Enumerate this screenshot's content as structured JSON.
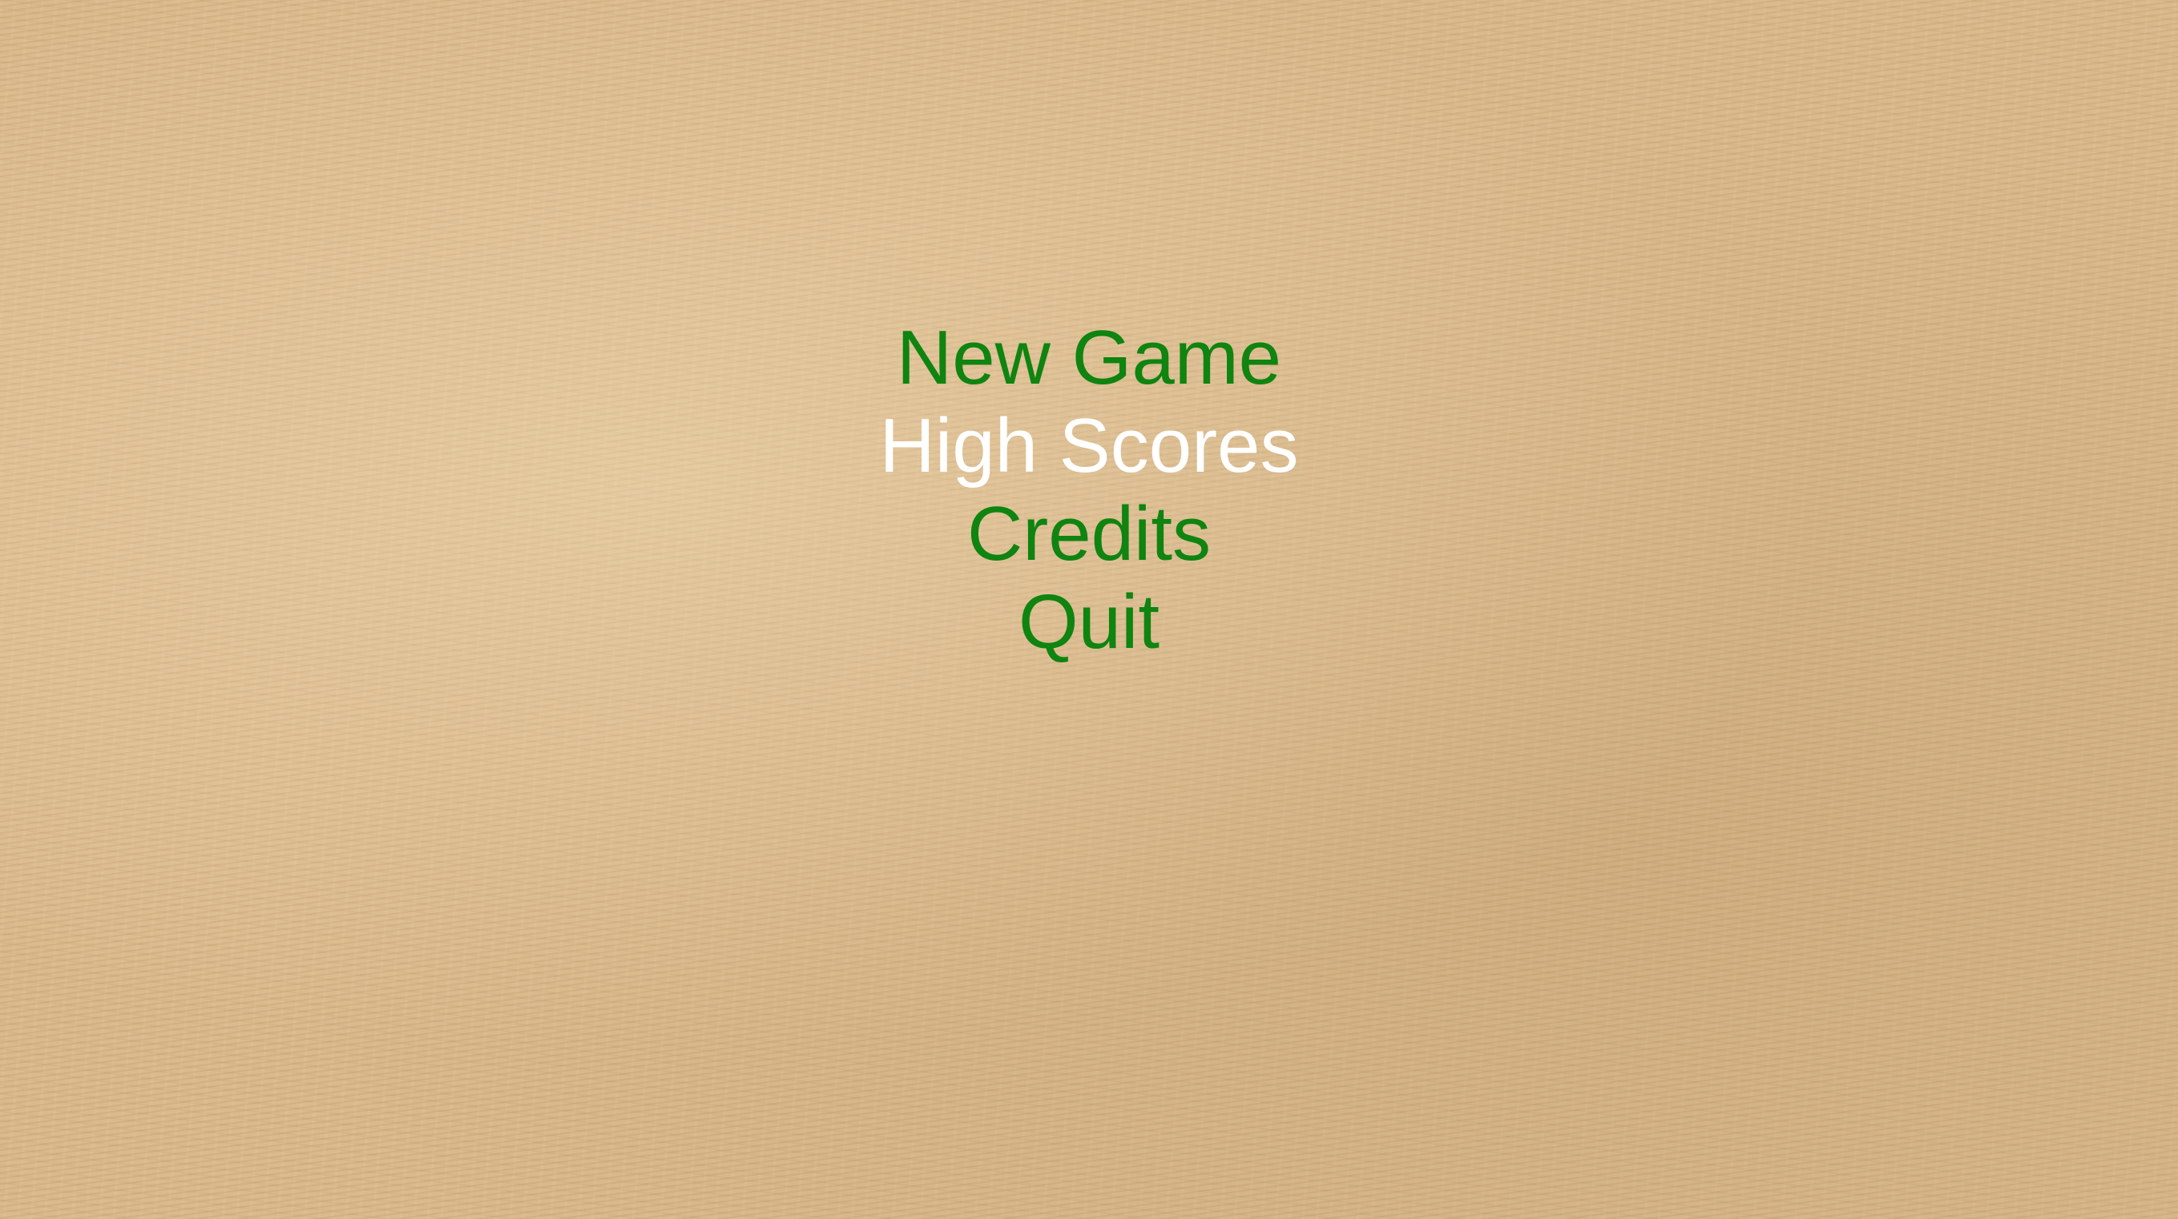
{
  "colors": {
    "menu_item": "#0f8410",
    "menu_item_selected": "#ffffff",
    "background": "#d9b88a"
  },
  "main_menu": {
    "items": [
      {
        "label": "New Game",
        "selected": false
      },
      {
        "label": "High Scores",
        "selected": true
      },
      {
        "label": "Credits",
        "selected": false
      },
      {
        "label": "Quit",
        "selected": false
      }
    ]
  }
}
